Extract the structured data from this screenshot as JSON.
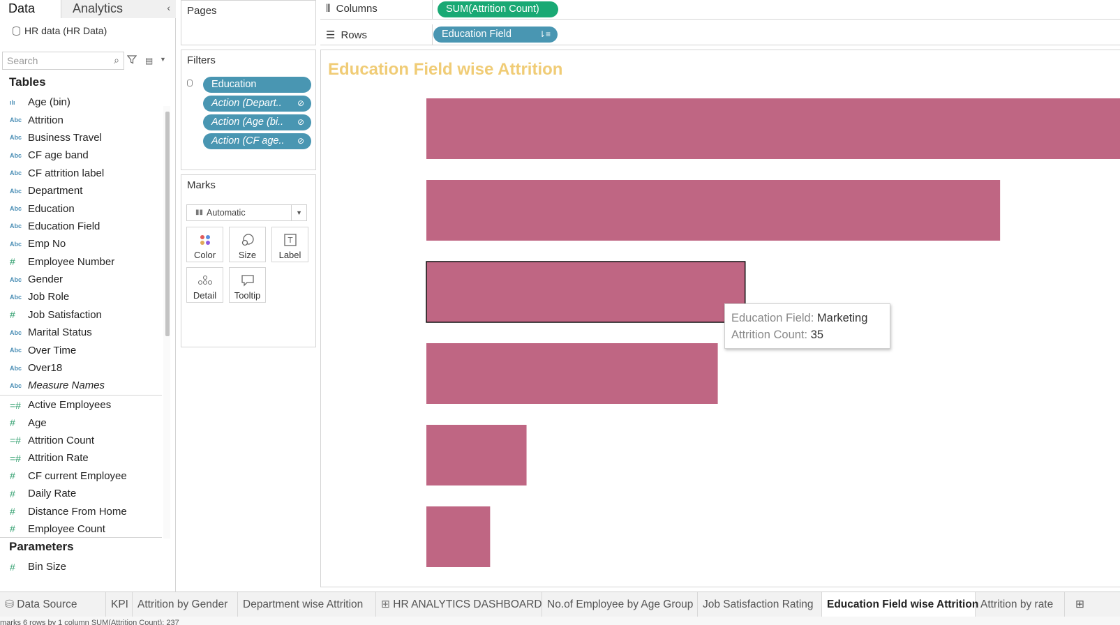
{
  "data_pane": {
    "tabs": [
      "Data",
      "Analytics"
    ],
    "collapse_icon": "chevron-left-icon",
    "data_source": "HR data (HR Data)",
    "search_placeholder": "Search",
    "tables_title": "Tables",
    "dimensions": [
      {
        "type": "bin",
        "name": "Age (bin)"
      },
      {
        "type": "Abc",
        "name": "Attrition"
      },
      {
        "type": "Abc",
        "name": "Business Travel"
      },
      {
        "type": "Abc",
        "name": "CF age band"
      },
      {
        "type": "Abc",
        "name": "CF attrition label"
      },
      {
        "type": "Abc",
        "name": "Department"
      },
      {
        "type": "Abc",
        "name": "Education"
      },
      {
        "type": "Abc",
        "name": "Education Field"
      },
      {
        "type": "Abc",
        "name": "Emp No"
      },
      {
        "type": "#",
        "name": "Employee Number"
      },
      {
        "type": "Abc",
        "name": "Gender"
      },
      {
        "type": "Abc",
        "name": "Job Role"
      },
      {
        "type": "#",
        "name": "Job Satisfaction"
      },
      {
        "type": "Abc",
        "name": "Marital Status"
      },
      {
        "type": "Abc",
        "name": "Over Time"
      },
      {
        "type": "Abc",
        "name": "Over18"
      },
      {
        "type": "Abc",
        "name": "Measure Names",
        "italic": true
      }
    ],
    "measures": [
      {
        "type": "=#",
        "name": "Active Employees"
      },
      {
        "type": "#",
        "name": "Age"
      },
      {
        "type": "=#",
        "name": "Attrition Count"
      },
      {
        "type": "=#",
        "name": "Attrition Rate"
      },
      {
        "type": "#",
        "name": "CF current Employee"
      },
      {
        "type": "#",
        "name": "Daily Rate"
      },
      {
        "type": "#",
        "name": "Distance From Home"
      },
      {
        "type": "#",
        "name": "Employee Count"
      }
    ],
    "parameters_title": "Parameters",
    "parameters": [
      {
        "type": "#",
        "name": "Bin Size"
      }
    ]
  },
  "pages_card": {
    "title": "Pages"
  },
  "filters_card": {
    "title": "Filters",
    "pills": [
      "Education",
      "Action (Depart..",
      "Action (Age (bi..",
      "Action (CF age.."
    ]
  },
  "marks_card": {
    "title": "Marks",
    "mark_type": "Automatic",
    "buttons": [
      "Color",
      "Size",
      "Label",
      "Detail",
      "Tooltip"
    ]
  },
  "shelves": {
    "columns_label": "Columns",
    "columns_pill": "SUM(Attrition Count)",
    "rows_label": "Rows",
    "rows_pill": "Education Field"
  },
  "viz": {
    "title": "Education Field wise Attrition",
    "accent_color": "#f0cc76",
    "bar_color": "#bf6683",
    "tooltip": {
      "field_label": "Education Field:",
      "field_value": "Marketing",
      "count_label": "Attrition Count:",
      "count_value": "35"
    }
  },
  "chart_data": {
    "type": "bar",
    "orientation": "horizontal",
    "title": "Education Field wise Attrition",
    "values": [
      80,
      63,
      35,
      32,
      11,
      7
    ],
    "highlighted_index": 2
  },
  "sheet_tabs": [
    {
      "label": "Data Source",
      "icon": "database-icon"
    },
    {
      "label": "KPI"
    },
    {
      "label": "Attrition by Gender"
    },
    {
      "label": "Department wise Attrition"
    },
    {
      "label": "HR ANALYTICS DASHBOARD",
      "icon": "dashboard-icon"
    },
    {
      "label": "No.of Employee by Age Group"
    },
    {
      "label": "Job Satisfaction Rating"
    },
    {
      "label": "Education Field wise Attrition",
      "active": true
    },
    {
      "label": "Attrition by rate"
    }
  ],
  "status_bar": "marks    6 rows by 1 column    SUM(Attrition Count): 237"
}
